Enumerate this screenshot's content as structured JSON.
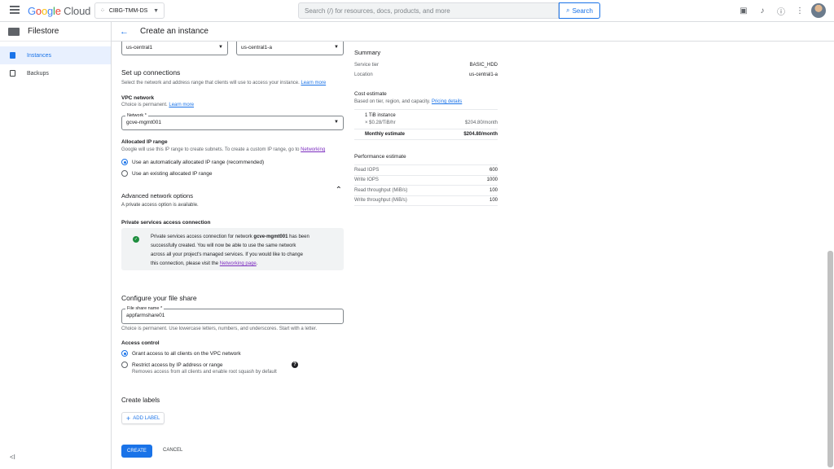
{
  "header": {
    "logo_google": "Google",
    "logo_cloud": "Cloud",
    "project": "CIBG-TMM-DS",
    "search_placeholder": "Search (/) for resources, docs, products, and more",
    "search_button": "Search"
  },
  "sidebar": {
    "product": "Filestore",
    "items": [
      {
        "label": "Instances",
        "active": true
      },
      {
        "label": "Backups",
        "active": false
      }
    ],
    "collapse_glyph": "<I"
  },
  "page": {
    "title": "Create an instance"
  },
  "form": {
    "region_value": "us-central1",
    "zone_value": "us-central1-a",
    "connections": {
      "title": "Set up connections",
      "desc": "Select the network and address range that clients will use to access your instance.",
      "learn_more": "Learn more"
    },
    "vpc": {
      "title": "VPC network",
      "desc": "Choice is permanent.",
      "learn_more": "Learn more",
      "network_label": "Network *",
      "network_value": "gcve-mgmt001"
    },
    "ip_range": {
      "title": "Allocated IP range",
      "desc": "Google will use this IP range to create subnets. To create a custom IP range, go to",
      "link": "Networking",
      "options": [
        {
          "label": "Use an automatically allocated IP range (recommended)",
          "selected": true
        },
        {
          "label": "Use an existing allocated IP range",
          "selected": false
        }
      ]
    },
    "advanced": {
      "title": "Advanced network options",
      "note": "A private access option is available."
    },
    "psa": {
      "title": "Private services access connection",
      "msg_1": "Private services access connection for network",
      "msg_network": "gcve-mgmt001",
      "msg_2": "has been",
      "msg_line2": "successfully created. You will now be able to use the same network",
      "msg_line3": "across all your project's managed services. If you would like to change",
      "msg_line4": "this connection, please visit the",
      "msg_link": "Networking page",
      "msg_end": "."
    },
    "file_share": {
      "title": "Configure your file share",
      "label": "File share name *",
      "value": "appfarmshare01",
      "hint": "Choice is permanent. Use lowercase letters, numbers, and underscores. Start with a letter."
    },
    "access": {
      "title": "Access control",
      "option1": "Grant access to all clients on the VPC network",
      "option2": "Restrict access by IP address or range",
      "option2_hint": "Removes access from all clients and enable root squash by default",
      "help_glyph": "?"
    },
    "labels": {
      "title": "Create labels",
      "add_button": "ADD LABEL"
    },
    "create_button": "CREATE",
    "cancel_button": "CANCEL"
  },
  "summary": {
    "title": "Summary",
    "service_tier_label": "Service tier",
    "service_tier_value": "BASIC_HDD",
    "location_label": "Location",
    "location_value": "us-central1-a",
    "cost_title": "Cost estimate",
    "cost_desc": "Based on tier, region, and capacity.",
    "pricing_link": "Pricing details",
    "instance_line": "1 TiB instance",
    "rate_line": "× $0.28/TiB/hr",
    "rate_month": "$204.80/month",
    "monthly_label": "Monthly estimate",
    "monthly_value": "$204.80/month",
    "perf_title": "Performance estimate",
    "perf": [
      {
        "label": "Read IOPS",
        "value": "600"
      },
      {
        "label": "Write IOPS",
        "value": "1000"
      },
      {
        "label": "Read throughput (MiB/s)",
        "value": "100"
      },
      {
        "label": "Write throughput (MiB/s)",
        "value": "100"
      }
    ]
  }
}
